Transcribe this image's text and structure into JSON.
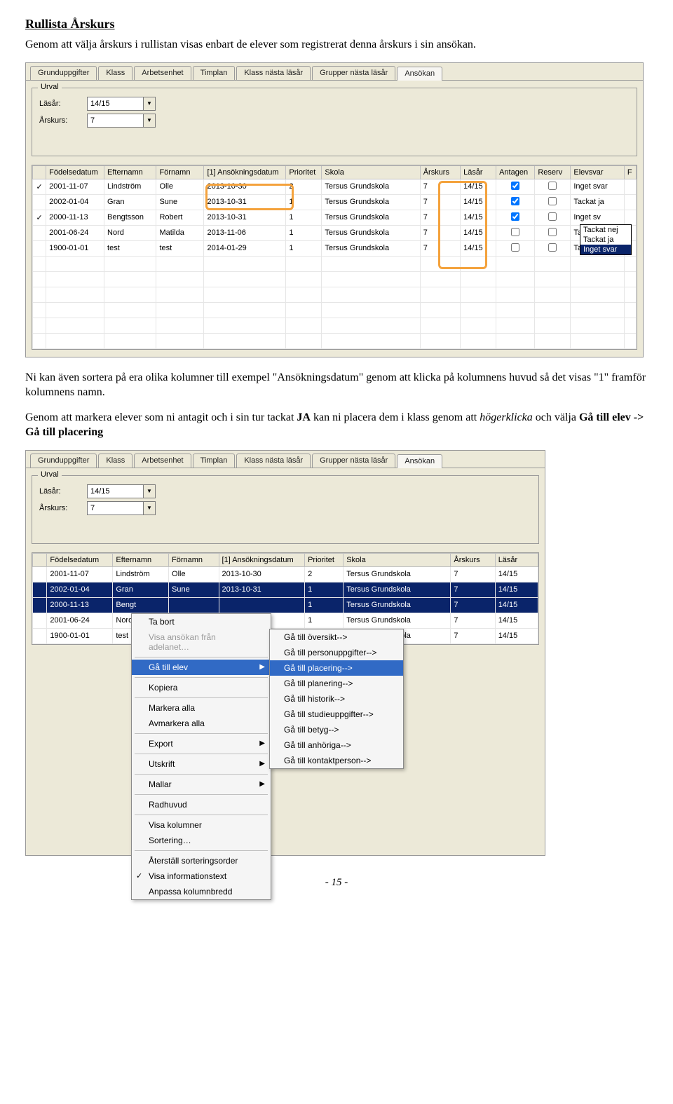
{
  "doc": {
    "heading1": "Rullista Årskurs",
    "para1": "Genom att välja årskurs i rullistan visas enbart de elever som registrerat denna årskurs i sin ansökan.",
    "para2_pre": "Ni kan även sortera på era olika kolumner till exempel \"Ansökningsdatum\" genom att klicka på kolumnens huvud så det visas \"1\" framför kolumnens namn.",
    "para3_a": "Genom att markera elever som ni antagit och i sin tur tackat ",
    "para3_bold": "JA",
    "para3_b": " kan ni placera dem i klass genom att ",
    "para3_italic": "högerklicka",
    "para3_c": " och välja ",
    "para3_bold2": "Gå till elev -> Gå till placering",
    "footer": "- 15 -"
  },
  "common": {
    "urval_label": "Urval",
    "lasar_label": "Läsår:",
    "arskurs_label": "Årskurs:",
    "lasar_value": "14/15",
    "arskurs_value": "7"
  },
  "tabs": [
    "Grunduppgifter",
    "Klass",
    "Arbetsenhet",
    "Timplan",
    "Klass nästa läsår",
    "Grupper nästa läsår",
    "Ansökan"
  ],
  "grid1": {
    "headers": [
      "",
      "Födelsedatum",
      "Efternamn",
      "Förnamn",
      "[1] Ansökningsdatum",
      "Prioritet",
      "Skola",
      "Årskurs",
      "Läsår",
      "Antagen",
      "Reserv",
      "Elevsvar",
      "F"
    ],
    "rows": [
      {
        "chk": "✓",
        "fod": "2001-11-07",
        "eft": "Lindström",
        "for": "Olle",
        "ans": "2013-10-30",
        "pri": "2",
        "sko": "Tersus Grundskola",
        "ark": "7",
        "las": "14/15",
        "ant": true,
        "res": false,
        "elev": "Inget svar"
      },
      {
        "chk": "",
        "fod": "2002-01-04",
        "eft": "Gran",
        "for": "Sune",
        "ans": "2013-10-31",
        "pri": "1",
        "sko": "Tersus Grundskola",
        "ark": "7",
        "las": "14/15",
        "ant": true,
        "res": false,
        "elev": "Tackat ja"
      },
      {
        "chk": "✓",
        "fod": "2000-11-13",
        "eft": "Bengtsson",
        "for": "Robert",
        "ans": "2013-10-31",
        "pri": "1",
        "sko": "Tersus Grundskola",
        "ark": "7",
        "las": "14/15",
        "ant": true,
        "res": false,
        "elev": "Inget sv"
      },
      {
        "chk": "",
        "fod": "2001-06-24",
        "eft": "Nord",
        "for": "Matilda",
        "ans": "2013-11-06",
        "pri": "1",
        "sko": "Tersus Grundskola",
        "ark": "7",
        "las": "14/15",
        "ant": false,
        "res": false,
        "elev": "Tackat nej"
      },
      {
        "chk": "",
        "fod": "1900-01-01",
        "eft": "test",
        "for": "test",
        "ans": "2014-01-29",
        "pri": "1",
        "sko": "Tersus Grundskola",
        "ark": "7",
        "las": "14/15",
        "ant": false,
        "res": false,
        "elev": "Tackat ja"
      }
    ],
    "elev_dropdown": [
      "Tackat nej",
      "Tackat ja",
      "Inget svar"
    ]
  },
  "grid2": {
    "headers": [
      "",
      "Födelsedatum",
      "Efternamn",
      "Förnamn",
      "[1] Ansökningsdatum",
      "Prioritet",
      "Skola",
      "Årskurs",
      "Läsår"
    ],
    "rows": [
      {
        "sel": false,
        "fod": "2001-11-07",
        "eft": "Lindström",
        "for": "Olle",
        "ans": "2013-10-30",
        "pri": "2",
        "sko": "Tersus Grundskola",
        "ark": "7",
        "las": "14/15"
      },
      {
        "sel": true,
        "fod": "2002-01-04",
        "eft": "Gran",
        "for": "Sune",
        "ans": "2013-10-31",
        "pri": "1",
        "sko": "Tersus Grundskola",
        "ark": "7",
        "las": "14/15"
      },
      {
        "sel": true,
        "fod": "2000-11-13",
        "eft": "Bengt",
        "for": "",
        "ans": "",
        "pri": "1",
        "sko": "Tersus Grundskola",
        "ark": "7",
        "las": "14/15"
      },
      {
        "sel": false,
        "fod": "2001-06-24",
        "eft": "Nord",
        "for": "",
        "ans": "",
        "pri": "1",
        "sko": "Tersus Grundskola",
        "ark": "7",
        "las": "14/15"
      },
      {
        "sel": false,
        "fod": "1900-01-01",
        "eft": "test",
        "for": "",
        "ans": "",
        "pri": "1",
        "sko": "Tersus Grundskola",
        "ark": "7",
        "las": "14/15"
      }
    ]
  },
  "ctxmenu": {
    "items": [
      {
        "label": "Ta bort"
      },
      {
        "label": "Visa ansökan från adelanet…",
        "disabled": true
      },
      {
        "sep": true
      },
      {
        "label": "Gå till elev",
        "arrow": true,
        "hover": true
      },
      {
        "sep": true
      },
      {
        "label": "Kopiera"
      },
      {
        "sep": true
      },
      {
        "label": "Markera alla"
      },
      {
        "label": "Avmarkera alla"
      },
      {
        "sep": true
      },
      {
        "label": "Export",
        "arrow": true
      },
      {
        "sep": true
      },
      {
        "label": "Utskrift",
        "arrow": true
      },
      {
        "sep": true
      },
      {
        "label": "Mallar",
        "arrow": true
      },
      {
        "sep": true
      },
      {
        "label": "Radhuvud"
      },
      {
        "sep": true
      },
      {
        "label": "Visa kolumner"
      },
      {
        "label": "Sortering…"
      },
      {
        "sep": true
      },
      {
        "label": "Återställ sorteringsorder"
      },
      {
        "label": "Visa informationstext",
        "check": true
      },
      {
        "label": "Anpassa kolumnbredd"
      }
    ],
    "submenu": [
      {
        "label": "Gå till översikt-->"
      },
      {
        "label": "Gå till personuppgifter-->"
      },
      {
        "label": "Gå till placering-->",
        "hover": true
      },
      {
        "label": "Gå till planering-->"
      },
      {
        "label": "Gå till historik-->"
      },
      {
        "label": "Gå till studieuppgifter-->"
      },
      {
        "label": "Gå till betyg-->"
      },
      {
        "label": "Gå till anhöriga-->"
      },
      {
        "label": "Gå till kontaktperson-->"
      }
    ]
  }
}
